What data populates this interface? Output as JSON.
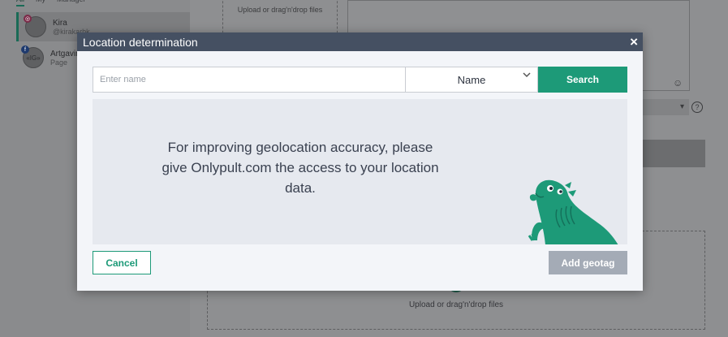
{
  "background": {
    "tabs": [
      "All",
      "My",
      "Manager"
    ],
    "accounts": [
      {
        "name": "Kira",
        "handle": "@kirakarbk",
        "network": "instagram"
      },
      {
        "name": "Artgavin",
        "handle": "Page",
        "network": "facebook",
        "avatar_text": "«IG»"
      }
    ],
    "upload_text_top": "Upload or drag'n'drop files",
    "upload_text_bottom": "Upload or drag'n'drop files",
    "help_glyph": "?",
    "emoji_glyph": "☺"
  },
  "modal": {
    "title": "Location determination",
    "close_glyph": "×",
    "search": {
      "placeholder": "Enter name",
      "value": "",
      "type_selected": "Name",
      "button": "Search"
    },
    "info_text": "For improving geolocation accuracy, please give Onlypult.com the access to your location data.",
    "cancel_label": "Cancel",
    "add_label": "Add geotag"
  },
  "colors": {
    "accent": "#1d9a78",
    "header": "#455062",
    "disabled": "#a4abb6"
  },
  "icons": {
    "close": "close-icon",
    "chevron": "chevron-down-icon",
    "mascot": "capybara-illustration"
  }
}
